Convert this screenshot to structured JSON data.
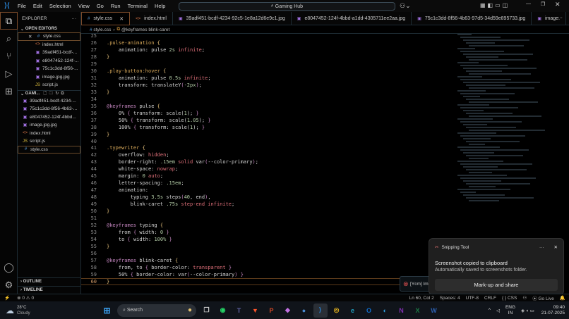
{
  "titlebar": {
    "menus": [
      "File",
      "Edit",
      "Selection",
      "View",
      "Go",
      "Run",
      "Terminal",
      "Help"
    ],
    "search": "Gaming Hub"
  },
  "sidebar": {
    "title": "EXPLORER",
    "open_editors_label": "OPEN EDITORS",
    "open_editors": [
      {
        "name": "style.css",
        "icon": "#",
        "color": "#5aa0e0"
      },
      {
        "name": "index.html",
        "icon": "<>",
        "color": "#e07a4a"
      },
      {
        "name": "39adf451-bcdf-...",
        "icon": "▣",
        "color": "#a070e0"
      },
      {
        "name": "e8047452-124f-...",
        "icon": "▣",
        "color": "#a070e0"
      },
      {
        "name": "75c1c3dd-8f56-...",
        "icon": "▣",
        "color": "#a070e0"
      },
      {
        "name": "image.jpg.jpg",
        "icon": "▣",
        "color": "#a070e0"
      },
      {
        "name": "script.js",
        "icon": "JS",
        "color": "#e0c040"
      }
    ],
    "folder_label": "GAMI...",
    "folder_files": [
      {
        "name": "39adf451-bcdf-4234-...",
        "icon": "▣",
        "color": "#a070e0"
      },
      {
        "name": "75c1c3dd-8f56-4b63-...",
        "icon": "▣",
        "color": "#a070e0"
      },
      {
        "name": "e8047452-124f-4bbd...",
        "icon": "▣",
        "color": "#a070e0"
      },
      {
        "name": "image.jpg.jpg",
        "icon": "▣",
        "color": "#a070e0"
      },
      {
        "name": "index.html",
        "icon": "<>",
        "color": "#e07a4a"
      },
      {
        "name": "script.js",
        "icon": "JS",
        "color": "#e0c040"
      },
      {
        "name": "style.css",
        "icon": "#",
        "color": "#5aa0e0"
      }
    ],
    "outline": "OUTLINE",
    "timeline": "TIMELINE"
  },
  "tabs": [
    {
      "name": "style.css",
      "icon": "#",
      "color": "#5aa0e0"
    },
    {
      "name": "index.html",
      "icon": "<>",
      "color": "#e07a4a"
    },
    {
      "name": "39adf451-bcdf-4234-92c5-1e8a12d6e9c1.jpg",
      "icon": "▣",
      "color": "#a070e0"
    },
    {
      "name": "e8047452-124f-4bbd-a1dd-4305711ee2aa.jpg",
      "icon": "▣",
      "color": "#a070e0"
    },
    {
      "name": "75c1c3dd-8f56-4b63-97d5-34d59e895733.jpg",
      "icon": "▣",
      "color": "#a070e0"
    },
    {
      "name": "image.",
      "icon": "▣",
      "color": "#a070e0"
    }
  ],
  "breadcrumb": {
    "file": "style.css",
    "symbol": "@keyframes blink-caret"
  },
  "code": [
    {
      "n": "25",
      "t": []
    },
    {
      "n": "26",
      "t": [
        [
          ".pulse-animation ",
          "sel-c"
        ],
        [
          "{",
          "br"
        ]
      ]
    },
    {
      "n": "27",
      "t": [
        [
          "    animation: ",
          "prop"
        ],
        [
          "pulse ",
          "prop"
        ],
        [
          "2s ",
          "num-c"
        ],
        [
          "infinite",
          "val"
        ],
        [
          ";",
          "pun"
        ]
      ]
    },
    {
      "n": "28",
      "t": [
        [
          "}",
          "br"
        ]
      ]
    },
    {
      "n": "29",
      "t": []
    },
    {
      "n": "30",
      "t": [
        [
          ".play-button:hover ",
          "sel-c"
        ],
        [
          "{",
          "br"
        ]
      ]
    },
    {
      "n": "31",
      "t": [
        [
          "    animation: ",
          "prop"
        ],
        [
          "pulse ",
          "prop"
        ],
        [
          "0.5s ",
          "num-c"
        ],
        [
          "infinite",
          "val"
        ],
        [
          ";",
          "pun"
        ]
      ]
    },
    {
      "n": "32",
      "t": [
        [
          "    transform: ",
          "prop"
        ],
        [
          "translateY",
          "prop"
        ],
        [
          "(",
          "kw"
        ],
        [
          "-2px",
          "num-c"
        ],
        [
          ")",
          "kw"
        ],
        [
          ";",
          "pun"
        ]
      ]
    },
    {
      "n": "33",
      "t": [
        [
          "}",
          "br"
        ]
      ]
    },
    {
      "n": "34",
      "t": []
    },
    {
      "n": "35",
      "t": [
        [
          "@keyframes ",
          "kw"
        ],
        [
          "pulse ",
          "prop"
        ],
        [
          "{",
          "br"
        ]
      ]
    },
    {
      "n": "36",
      "t": [
        [
          "    0% ",
          "prop"
        ],
        [
          "{ ",
          "kw"
        ],
        [
          "transform: scale(",
          "prop"
        ],
        [
          "1",
          "num-c"
        ],
        [
          "); ",
          "prop"
        ],
        [
          "}",
          "kw"
        ]
      ]
    },
    {
      "n": "37",
      "t": [
        [
          "    50% ",
          "prop"
        ],
        [
          "{ ",
          "kw"
        ],
        [
          "transform: scale(",
          "prop"
        ],
        [
          "1.05",
          "num-c"
        ],
        [
          "); ",
          "prop"
        ],
        [
          "}",
          "kw"
        ]
      ]
    },
    {
      "n": "38",
      "t": [
        [
          "    100% ",
          "prop"
        ],
        [
          "{ ",
          "kw"
        ],
        [
          "transform: scale(",
          "prop"
        ],
        [
          "1",
          "num-c"
        ],
        [
          "); ",
          "prop"
        ],
        [
          "}",
          "kw"
        ]
      ]
    },
    {
      "n": "39",
      "t": [
        [
          "}",
          "br"
        ]
      ]
    },
    {
      "n": "40",
      "t": []
    },
    {
      "n": "41",
      "t": [
        [
          ".typewriter ",
          "sel-c"
        ],
        [
          "{",
          "br"
        ]
      ]
    },
    {
      "n": "42",
      "t": [
        [
          "    overflow: ",
          "prop"
        ],
        [
          "hidden",
          "val"
        ],
        [
          ";",
          "pun"
        ]
      ]
    },
    {
      "n": "43",
      "t": [
        [
          "    border-right: ",
          "prop"
        ],
        [
          ".15em ",
          "num-c"
        ],
        [
          "solid ",
          "val"
        ],
        [
          "var",
          "prop"
        ],
        [
          "(",
          "kw"
        ],
        [
          "--color-primary",
          "prop"
        ],
        [
          ")",
          "kw"
        ],
        [
          ";",
          "pun"
        ]
      ]
    },
    {
      "n": "44",
      "t": [
        [
          "    white-space: ",
          "prop"
        ],
        [
          "nowrap",
          "val"
        ],
        [
          ";",
          "pun"
        ]
      ]
    },
    {
      "n": "45",
      "t": [
        [
          "    margin: ",
          "prop"
        ],
        [
          "0 ",
          "num-c"
        ],
        [
          "auto",
          "val"
        ],
        [
          ";",
          "pun"
        ]
      ]
    },
    {
      "n": "46",
      "t": [
        [
          "    letter-spacing: ",
          "prop"
        ],
        [
          ".15em",
          "num-c"
        ],
        [
          ";",
          "pun"
        ]
      ]
    },
    {
      "n": "47",
      "t": [
        [
          "    animation:",
          "prop"
        ]
      ]
    },
    {
      "n": "48",
      "t": [
        [
          "        typing ",
          "prop"
        ],
        [
          "3.5s ",
          "num-c"
        ],
        [
          "steps",
          "prop"
        ],
        [
          "(",
          "kw"
        ],
        [
          "40",
          "num-c"
        ],
        [
          ", end",
          "prop"
        ],
        [
          ")",
          "kw"
        ],
        [
          ",",
          "pun"
        ]
      ]
    },
    {
      "n": "49",
      "t": [
        [
          "        blink-caret ",
          "prop"
        ],
        [
          ".75s ",
          "num-c"
        ],
        [
          "step-end infinite",
          "val"
        ],
        [
          ";",
          "pun"
        ]
      ]
    },
    {
      "n": "50",
      "t": [
        [
          "}",
          "br"
        ]
      ]
    },
    {
      "n": "51",
      "t": []
    },
    {
      "n": "52",
      "t": [
        [
          "@keyframes ",
          "kw"
        ],
        [
          "typing ",
          "prop"
        ],
        [
          "{",
          "br"
        ]
      ]
    },
    {
      "n": "53",
      "t": [
        [
          "    from ",
          "prop"
        ],
        [
          "{ ",
          "kw"
        ],
        [
          "width: ",
          "prop"
        ],
        [
          "0 ",
          "num-c"
        ],
        [
          "}",
          "kw"
        ]
      ]
    },
    {
      "n": "54",
      "t": [
        [
          "    to ",
          "prop"
        ],
        [
          "{ ",
          "kw"
        ],
        [
          "width: ",
          "prop"
        ],
        [
          "100% ",
          "num-c"
        ],
        [
          "}",
          "kw"
        ]
      ]
    },
    {
      "n": "55",
      "t": [
        [
          "}",
          "br"
        ]
      ]
    },
    {
      "n": "56",
      "t": []
    },
    {
      "n": "57",
      "t": [
        [
          "@keyframes ",
          "kw"
        ],
        [
          "blink-caret ",
          "prop"
        ],
        [
          "{",
          "br"
        ]
      ]
    },
    {
      "n": "58",
      "t": [
        [
          "    from, to ",
          "prop"
        ],
        [
          "{ ",
          "kw"
        ],
        [
          "border-color: ",
          "prop"
        ],
        [
          "transparent ",
          "val"
        ],
        [
          "}",
          "kw"
        ]
      ]
    },
    {
      "n": "59",
      "t": [
        [
          "    50% ",
          "prop"
        ],
        [
          "{ ",
          "kw"
        ],
        [
          "border-color: ",
          "prop"
        ],
        [
          "var",
          "prop"
        ],
        [
          "(",
          "kw"
        ],
        [
          "--color-primary",
          "prop"
        ],
        [
          ") ",
          "kw"
        ],
        [
          "}",
          "kw"
        ]
      ]
    },
    {
      "n": "60",
      "t": [
        [
          "}",
          "br"
        ]
      ]
    }
  ],
  "toast": "[Ycm] Im",
  "notification": {
    "app": "Snipping Tool",
    "title": "Screenshot copied to clipboard",
    "body": "Automatically saved to screenshots folder.",
    "action": "Mark-up and share",
    "more": "···",
    "close": "✕"
  },
  "statusbar": {
    "errors": "0",
    "warnings": "0",
    "position": "Ln 60, Col 2",
    "spaces": "Spaces: 4",
    "encoding": "UTF-8",
    "eol": "CRLF",
    "language": "{ } CSS",
    "golive": "Go Live"
  },
  "taskbar": {
    "temp": "28°C",
    "weather": "Cloudy",
    "search": "Search",
    "lang1": "ENG",
    "lang2": "IN",
    "time": "09:40",
    "date": "21-07-2025",
    "apps": [
      {
        "n": "whatsapp",
        "c": "#25d366",
        "g": "◉"
      },
      {
        "n": "teams",
        "c": "#6264a7",
        "g": "T"
      },
      {
        "n": "brave",
        "c": "#fb542b",
        "g": "▼"
      },
      {
        "n": "powerpoint",
        "c": "#d24726",
        "g": "P"
      },
      {
        "n": "copilot",
        "c": "#c070e0",
        "g": "◆"
      },
      {
        "n": "app",
        "c": "#4a8ad0",
        "g": "●"
      },
      {
        "n": "vscode",
        "c": "#2a8ae0",
        "g": "⟩"
      },
      {
        "n": "chrome",
        "c": "#e0b020",
        "g": "◎"
      },
      {
        "n": "edge",
        "c": "#1fa0c0",
        "g": "e"
      },
      {
        "n": "outlook",
        "c": "#1070d0",
        "g": "O"
      },
      {
        "n": "app2",
        "c": "#30a0e0",
        "g": "◐"
      },
      {
        "n": "onenote",
        "c": "#8030b0",
        "g": "N"
      },
      {
        "n": "excel",
        "c": "#1d7a45",
        "g": "X"
      },
      {
        "n": "word",
        "c": "#2b5fb0",
        "g": "W"
      }
    ]
  }
}
